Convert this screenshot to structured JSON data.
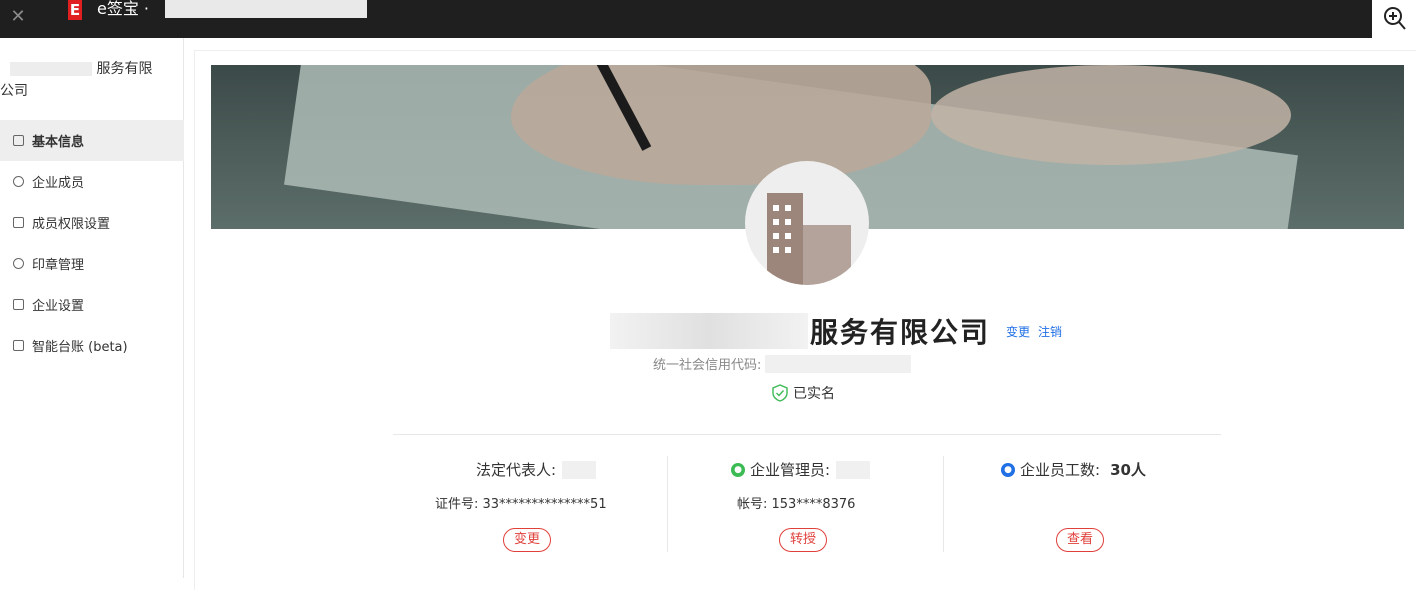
{
  "window": {
    "app_name": "e签宝 ·",
    "logo_letter": "E"
  },
  "sidebar": {
    "company_short_suffix": "服务有限",
    "company_short_line2": "公司",
    "items": [
      {
        "label": "基本信息",
        "active": true,
        "icon": "document-icon"
      },
      {
        "label": "企业成员",
        "active": false,
        "icon": "members-icon"
      },
      {
        "label": "成员权限设置",
        "active": false,
        "icon": "permission-icon"
      },
      {
        "label": "印章管理",
        "active": false,
        "icon": "seal-icon"
      },
      {
        "label": "企业设置",
        "active": false,
        "icon": "settings-doc-icon"
      },
      {
        "label": "智能台账 (beta)",
        "active": false,
        "icon": "ledger-icon"
      }
    ]
  },
  "profile": {
    "company_name_suffix": "服务有限公司",
    "change_link": "变更",
    "cancel_link": "注销",
    "credit_code_label": "统一社会信用代码:",
    "verified_text": "已实名"
  },
  "legal_rep": {
    "title": "法定代表人:",
    "id_label": "证件号: 33**************51",
    "button": "变更"
  },
  "admin": {
    "title": "企业管理员:",
    "account_label": "帐号: 153****8376",
    "button": "转授"
  },
  "employees": {
    "title": "企业员工数:",
    "count": "30人",
    "button": "查看"
  },
  "colors": {
    "accent_red": "#e0403a",
    "link_blue": "#1f6fe5",
    "verified_green": "#3cba54",
    "topbar": "#1f1f1f"
  }
}
